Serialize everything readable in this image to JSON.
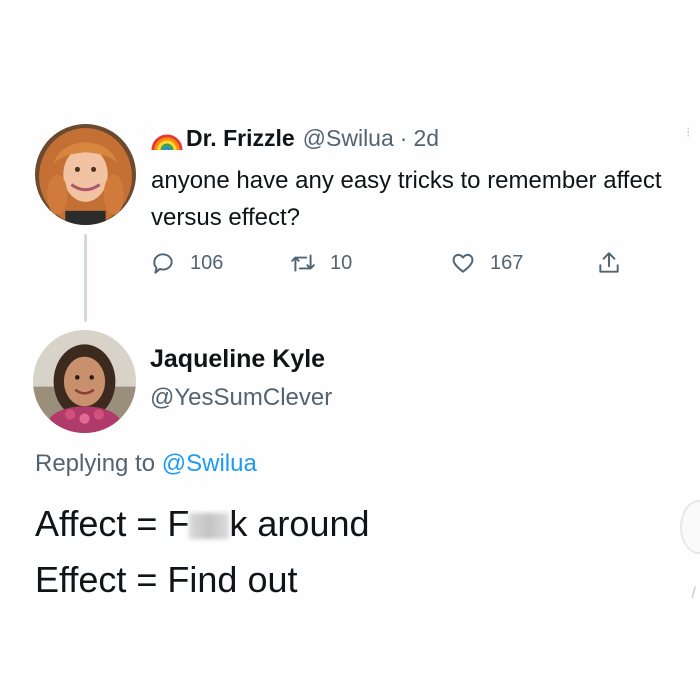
{
  "tweet": {
    "author_name": "Dr. Frizzle",
    "author_handle": "@Swilua",
    "separator": "·",
    "time": "2d",
    "text": "anyone have any easy tricks to remember affect versus effect?",
    "stats": {
      "replies": "106",
      "retweets": "10",
      "likes": "167"
    },
    "icons": {
      "reply": "reply-icon",
      "retweet": "retweet-icon",
      "like": "heart-icon",
      "share": "share-icon",
      "badge": "rainbow-icon"
    }
  },
  "reply": {
    "author_name": "Jaqueline Kyle",
    "author_handle": "@YesSumClever",
    "replying_prefix": "Replying to",
    "replying_handle": "@Swilua",
    "line1_before": "Affect = F",
    "line1_after": "k around",
    "line2": "Effect = Find out"
  },
  "colors": {
    "text": "#0f1419",
    "secondary": "#536471",
    "link": "#1d9bf0",
    "thread_line": "#cfd9de"
  }
}
